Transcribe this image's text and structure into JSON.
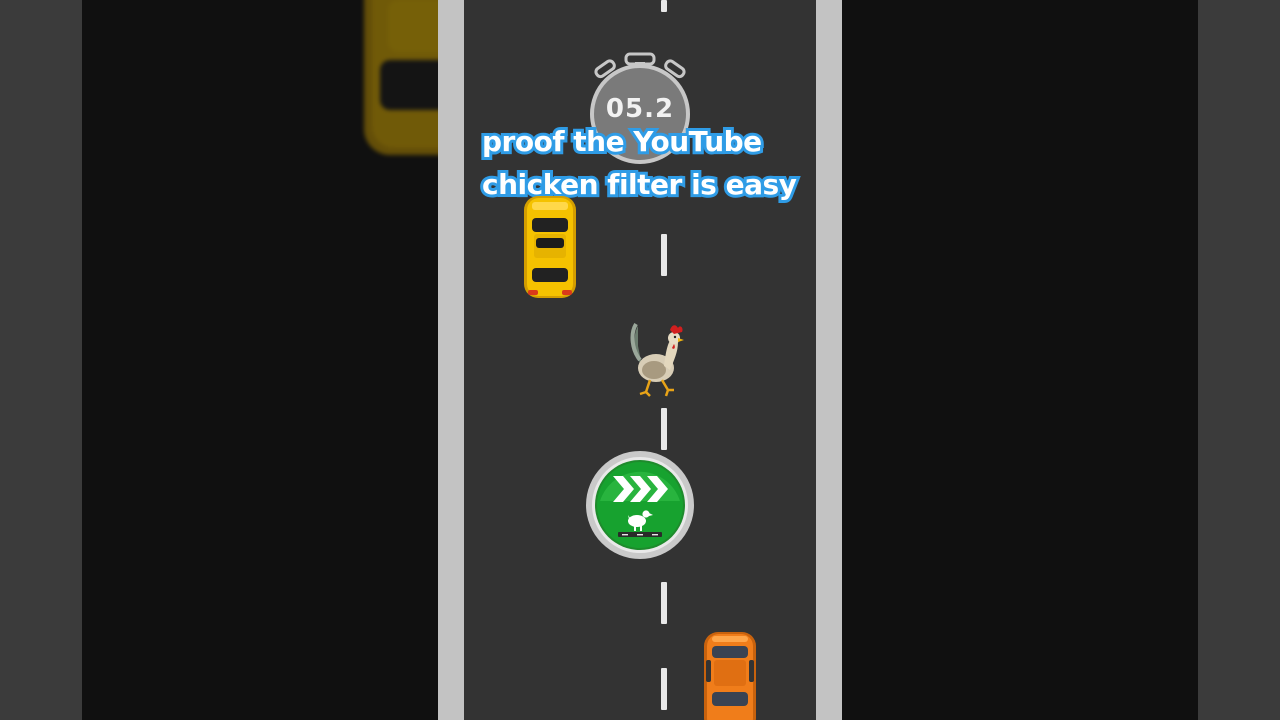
{
  "timer": {
    "value": "05.2",
    "icon": "stopwatch-icon"
  },
  "caption": {
    "line1": "proof the YouTube",
    "line2": "chicken filter is easy"
  },
  "controls": {
    "go_button_icon": "chevron-chicken-cross-icon"
  },
  "colors": {
    "road": "#333333",
    "shoulder": "#c3c3c3",
    "caption_outline": "#2f9ce6",
    "button_green": "#16a02e",
    "car_yellow": "#f5c200",
    "car_orange": "#f07d1a"
  }
}
